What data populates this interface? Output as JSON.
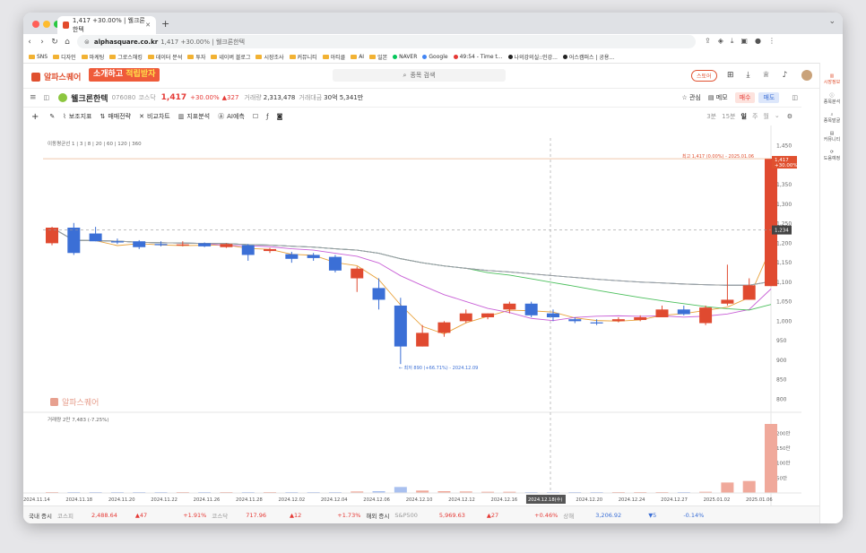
{
  "browser": {
    "tab_title": "1,417 +30.00% | 웰크론한텍",
    "url_domain": "alphasquare.co.kr",
    "url_rest": "1,417 +30.00% | 웰크론한텍",
    "bookmarks": [
      "SNS",
      "디자인",
      "마케팅",
      "그로스해킹",
      "데이터 분석",
      "투자",
      "네이버 블로그",
      "시장조사",
      "커뮤니티",
      "아티클",
      "AI",
      "일본",
      "NAVER",
      "Google",
      "49:54 - Time t...",
      "나의강의실::인강...",
      "어스캠퍼스 | 공용..."
    ]
  },
  "site": {
    "logo": "알파스퀘어",
    "promo_a": "소개하고 ",
    "promo_b": "적립받자",
    "search_placeholder": "종목 검색",
    "store_button": "스토어"
  },
  "stock": {
    "name": "웰크론한텍",
    "code": "076080",
    "market": "코스닥",
    "price": "1,417",
    "change_pct": "+30.00%",
    "change_abs": "▲327",
    "volume_label": "거래량",
    "volume": "2,313,478",
    "amount_label": "거래대금",
    "amount": "30억 5,341만",
    "interest_label": "관심",
    "memo_label": "메모",
    "buy_label": "매수",
    "sell_label": "매도"
  },
  "toolbar": {
    "indicators": "보조지표",
    "strategy": "매매전략",
    "compare": "비교차트",
    "analysis": "지표분석",
    "ai": "AI예측",
    "periods": [
      "3분",
      "15분",
      "일",
      "주",
      "월"
    ],
    "selected_period": "일"
  },
  "chart_data": {
    "type": "candlestick",
    "ma_legend": "이동평균선 1 | 3 | 8 | 20 | 60 | 120 | 360",
    "ma_periods": [
      3,
      8,
      20,
      60,
      120,
      360
    ],
    "price_ticks": [
      1450,
      1400,
      1350,
      1300,
      1250,
      1200,
      1150,
      1100,
      1050,
      1000,
      950,
      900,
      850,
      800
    ],
    "price_range": [
      780,
      1470
    ],
    "x_labels": [
      "2024.11.14",
      "2024.11.18",
      "2024.11.20",
      "2024.11.22",
      "2024.11.26",
      "2024.11.28",
      "2024.12.02",
      "2024.12.04",
      "2024.12.06",
      "2024.12.10",
      "2024.12.12",
      "2024.12.16",
      "2024.12.18(수)",
      "2024.12.20",
      "2024.12.24",
      "2024.12.27",
      "2025.01.02",
      "2025.01.06"
    ],
    "candles": [
      {
        "o": 1200,
        "h": 1242,
        "l": 1195,
        "c": 1240
      },
      {
        "o": 1240,
        "h": 1252,
        "l": 1170,
        "c": 1175
      },
      {
        "o": 1225,
        "h": 1242,
        "l": 1205,
        "c": 1205
      },
      {
        "o": 1205,
        "h": 1212,
        "l": 1198,
        "c": 1202
      },
      {
        "o": 1205,
        "h": 1208,
        "l": 1185,
        "c": 1190
      },
      {
        "o": 1198,
        "h": 1205,
        "l": 1192,
        "c": 1195
      },
      {
        "o": 1196,
        "h": 1205,
        "l": 1192,
        "c": 1197
      },
      {
        "o": 1200,
        "h": 1202,
        "l": 1190,
        "c": 1192
      },
      {
        "o": 1190,
        "h": 1200,
        "l": 1188,
        "c": 1198
      },
      {
        "o": 1195,
        "h": 1198,
        "l": 1155,
        "c": 1170
      },
      {
        "o": 1180,
        "h": 1188,
        "l": 1175,
        "c": 1185
      },
      {
        "o": 1172,
        "h": 1178,
        "l": 1150,
        "c": 1160
      },
      {
        "o": 1170,
        "h": 1175,
        "l": 1155,
        "c": 1162
      },
      {
        "o": 1165,
        "h": 1170,
        "l": 1125,
        "c": 1130
      },
      {
        "o": 1110,
        "h": 1140,
        "l": 1075,
        "c": 1135
      },
      {
        "o": 1085,
        "h": 1110,
        "l": 1030,
        "c": 1055
      },
      {
        "o": 1040,
        "h": 1060,
        "l": 890,
        "c": 935
      },
      {
        "o": 935,
        "h": 990,
        "l": 935,
        "c": 970
      },
      {
        "o": 970,
        "h": 1000,
        "l": 960,
        "c": 997
      },
      {
        "o": 1000,
        "h": 1030,
        "l": 995,
        "c": 1020
      },
      {
        "o": 1010,
        "h": 1020,
        "l": 1005,
        "c": 1020
      },
      {
        "o": 1030,
        "h": 1050,
        "l": 1020,
        "c": 1045
      },
      {
        "o": 1045,
        "h": 1050,
        "l": 1010,
        "c": 1015
      },
      {
        "o": 1020,
        "h": 1030,
        "l": 1000,
        "c": 1010
      },
      {
        "o": 1005,
        "h": 1010,
        "l": 995,
        "c": 1000
      },
      {
        "o": 997,
        "h": 1005,
        "l": 990,
        "c": 995
      },
      {
        "o": 1000,
        "h": 1010,
        "l": 997,
        "c": 1005
      },
      {
        "o": 1003,
        "h": 1015,
        "l": 1000,
        "c": 1010
      },
      {
        "o": 1010,
        "h": 1040,
        "l": 1010,
        "c": 1030
      },
      {
        "o": 1030,
        "h": 1040,
        "l": 1015,
        "c": 1018
      },
      {
        "o": 995,
        "h": 1040,
        "l": 990,
        "c": 1035
      },
      {
        "o": 1045,
        "h": 1145,
        "l": 1040,
        "c": 1055
      },
      {
        "o": 1055,
        "h": 1110,
        "l": 1055,
        "c": 1092
      },
      {
        "o": 1090,
        "h": 1417,
        "l": 1090,
        "c": 1417
      }
    ],
    "high_label": "최고 1,417 (0.00%) - 2025.01.06",
    "low_label": "최저 890 (+66.71%) - 2024.12.09",
    "current_price_tag": "1,417",
    "current_change_tag": "+30.00%",
    "crosshair_price": "1,234",
    "watermark": "알파스퀘어",
    "volume_legend": "거래량 2만 7,483 (-7.25%)",
    "volume_ticks": [
      "200만",
      "150만",
      "100만",
      "50만"
    ],
    "volumes": [
      3,
      2,
      2,
      1,
      1,
      2,
      1,
      1,
      1,
      1,
      1,
      2,
      1,
      2,
      5,
      6,
      20,
      8,
      6,
      5,
      4,
      4,
      3,
      3,
      2,
      2,
      2,
      2,
      3,
      3,
      4,
      35,
      40,
      231
    ]
  },
  "market": {
    "domestic_label": "국내 증시",
    "kospi_label": "코스피",
    "kospi_value": "2,488.64",
    "kospi_chg": "▲47",
    "kospi_pct": "+1.91%",
    "kosdaq_label": "코스닥",
    "kosdaq_value": "717.96",
    "kosdaq_chg": "▲12",
    "kosdaq_pct": "+1.73%",
    "foreign_label": "해외 증시",
    "sp_label": "S&P500",
    "sp_value": "5,969.63",
    "sp_chg": "▲27",
    "sp_pct": "+0.46%",
    "sh_label": "상해",
    "sh_value": "3,206.92",
    "sh_chg": "▼5",
    "sh_pct": "-0.14%"
  },
  "right_sidebar": [
    "시장정보",
    "종목분석",
    "종목발굴",
    "커뮤니티",
    "도움예정"
  ],
  "colors": {
    "up": "#e04a30",
    "down": "#3b6fd6",
    "accent": "#e0502f"
  }
}
